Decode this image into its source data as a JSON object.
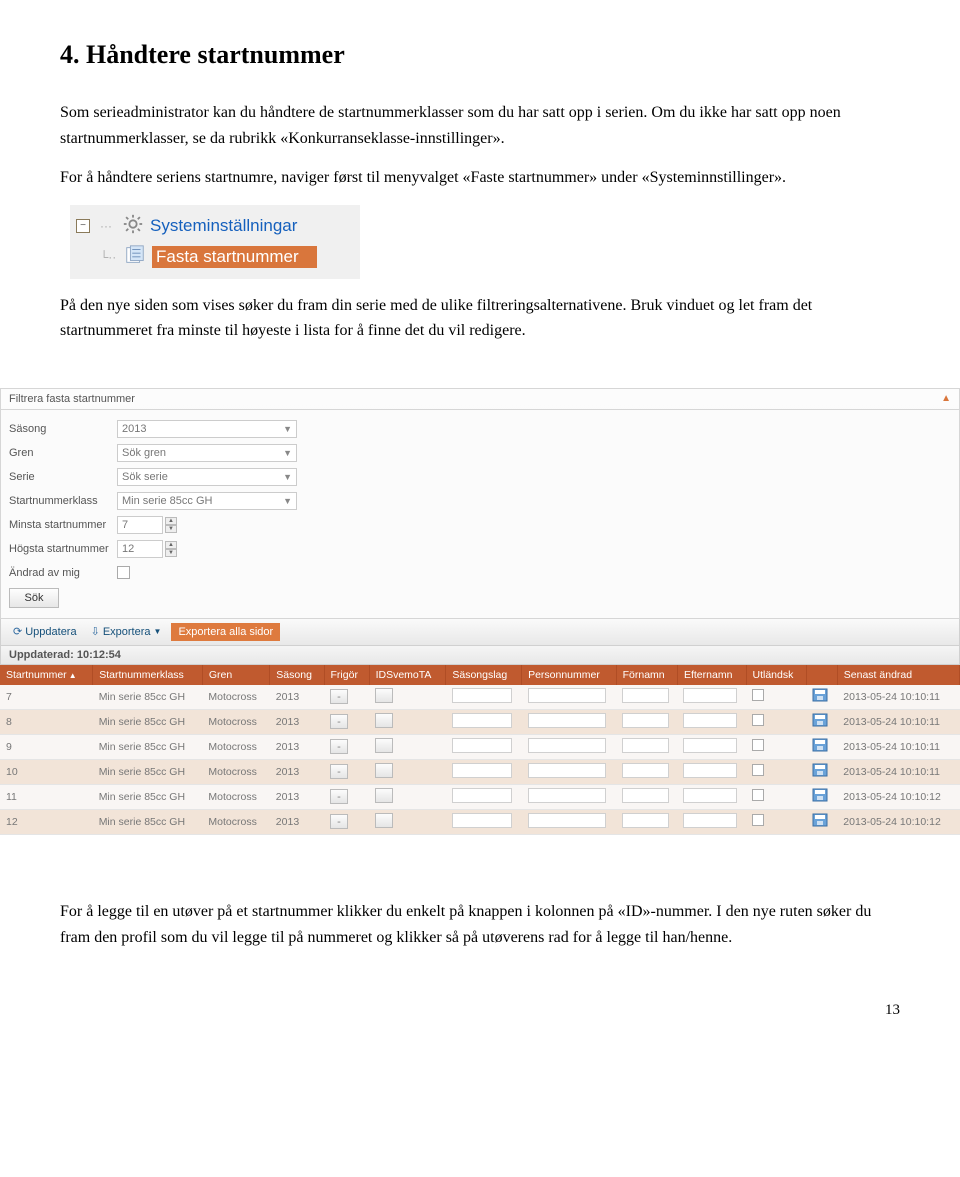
{
  "doc": {
    "heading": "4.   Håndtere startnummer",
    "p1": "Som serieadministrator kan du håndtere de startnummerklasser som du har satt opp i serien. Om du ikke har satt opp noen startnummerklasser, se da rubrikk «Konkurranseklasse-innstillinger».",
    "p2": "For å håndtere seriens startnumre, naviger først til menyvalget «Faste startnummer» under «Systeminnstillinger».",
    "tree_parent": "Systeminställningar",
    "tree_child": "Fasta startnummer",
    "p3": "På den nye siden som vises søker du fram din serie med de ulike filtreringsalternativene. Bruk vinduet og let fram det startnummeret fra minste til høyeste i lista for å finne det du vil redigere.",
    "filter_title": "Filtrera fasta startnummer",
    "f_sasong_label": "Säsong",
    "f_sasong_value": "2013",
    "f_gren_label": "Gren",
    "f_gren_value": "Sök gren",
    "f_serie_label": "Serie",
    "f_serie_value": "Sök serie",
    "f_klass_label": "Startnummerklass",
    "f_klass_value": "Min serie 85cc GH",
    "f_min_label": "Minsta startnummer",
    "f_min_value": "7",
    "f_max_label": "Högsta startnummer",
    "f_max_value": "12",
    "f_andrad_label": "Ändrad av mig",
    "f_sok": "Sök",
    "tb_upd": "Uppdatera",
    "tb_exp": "Exportera",
    "tb_expall": "Exportera alla sidor",
    "tb_time": "Uppdaterad: 10:12:54",
    "cols": {
      "c1": "Startnummer",
      "c2": "Startnummerklass",
      "c3": "Gren",
      "c4": "Säsong",
      "c5": "Frigör",
      "c6": "IDSvemoTA",
      "c7": "Säsongslag",
      "c8": "Personnummer",
      "c9": "Förnamn",
      "c10": "Efternamn",
      "c11": "Utländsk",
      "c12": "",
      "c13": "Senast ändrad"
    },
    "rows": [
      {
        "n": "7",
        "klass": "Min serie 85cc GH",
        "gren": "Motocross",
        "sas": "2013",
        "datum": "2013-05-24 10:10:11"
      },
      {
        "n": "8",
        "klass": "Min serie 85cc GH",
        "gren": "Motocross",
        "sas": "2013",
        "datum": "2013-05-24 10:10:11"
      },
      {
        "n": "9",
        "klass": "Min serie 85cc GH",
        "gren": "Motocross",
        "sas": "2013",
        "datum": "2013-05-24 10:10:11"
      },
      {
        "n": "10",
        "klass": "Min serie 85cc GH",
        "gren": "Motocross",
        "sas": "2013",
        "datum": "2013-05-24 10:10:11"
      },
      {
        "n": "11",
        "klass": "Min serie 85cc GH",
        "gren": "Motocross",
        "sas": "2013",
        "datum": "2013-05-24 10:10:12"
      },
      {
        "n": "12",
        "klass": "Min serie 85cc GH",
        "gren": "Motocross",
        "sas": "2013",
        "datum": "2013-05-24 10:10:12"
      }
    ],
    "p4": "For å legge til en utøver på et startnummer klikker du enkelt på knappen i kolonnen på «ID»-nummer. I den nye ruten søker du fram den profil som du vil legge til på nummeret og klikker så på utøverens rad for å legge til han/henne.",
    "page_number": "13"
  }
}
